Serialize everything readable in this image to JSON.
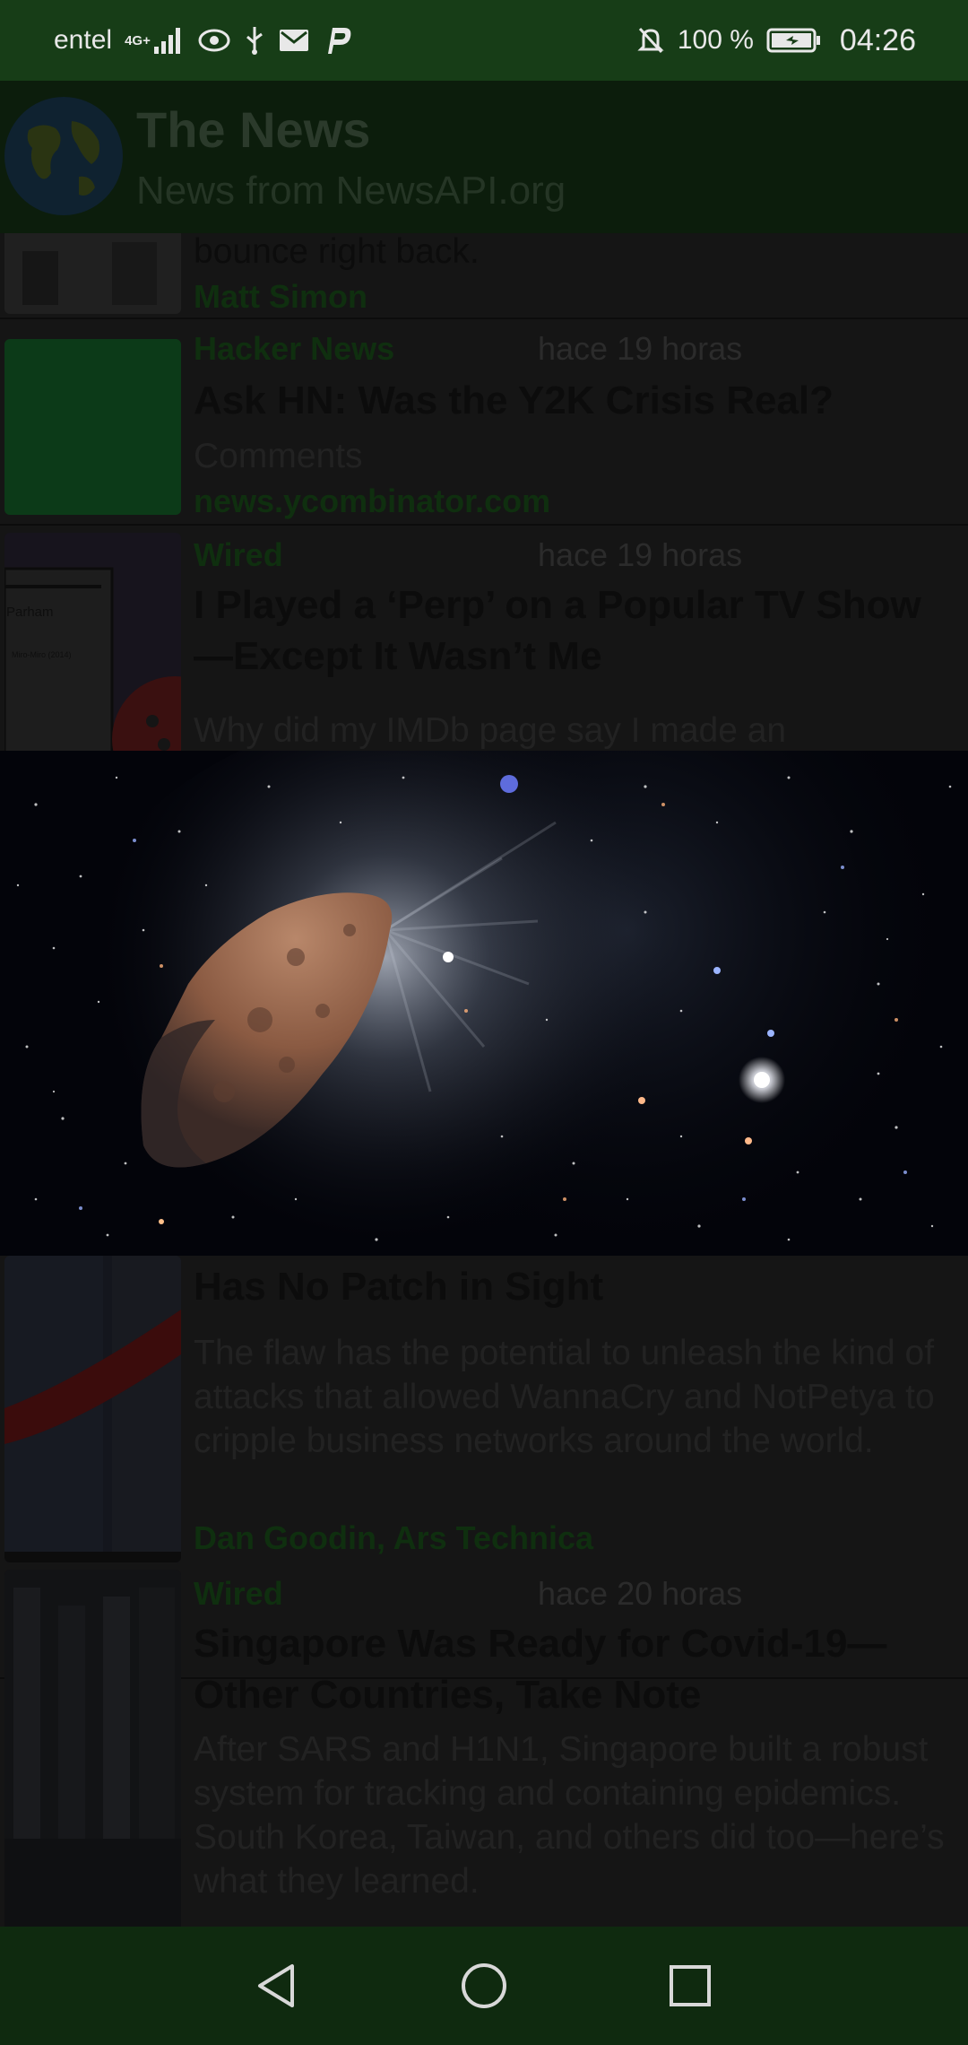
{
  "status_bar": {
    "carrier": "entel",
    "network": "4G+",
    "battery": "100 %",
    "time": "04:26",
    "icons": [
      "signal-icon",
      "eye-icon",
      "usb-icon",
      "gmail-icon",
      "parking-icon",
      "mute-icon",
      "battery-charging-icon"
    ]
  },
  "app_bar": {
    "title": "The News",
    "subtitle": "News from NewsAPI.org",
    "logo_icon": "globe-icon"
  },
  "articles": [
    {
      "title": "bounce right back.",
      "author": "Matt Simon"
    },
    {
      "source": "Hacker News",
      "time": "hace 19 horas",
      "title": "Ask HN: Was the Y2K Crisis Real?",
      "description": "Comments",
      "author": "news.ycombinator.com"
    },
    {
      "source": "Wired",
      "time": "hace 19 horas",
      "title": "I Played a ‘Perp’ on a Popular TV Show—Except It Wasn’t Me",
      "description": "Why did my IMDb page say I made an",
      "thumb_text_1": "Parham",
      "thumb_text_2": "Miro-Miro (2014)"
    },
    {
      "title": "Has No Patch in Sight",
      "description": "The flaw has the potential to unleash the kind of attacks that allowed WannaCry and NotPetya to cripple business networks around the world.",
      "author": "Dan Goodin, Ars Technica"
    },
    {
      "source": "Wired",
      "time": "hace 20 horas",
      "title": "Singapore Was Ready for Covid-19—Other Countries, Take Note",
      "description": "After SARS and H1N1, Singapore built a robust system for tracking and containing epidemics. South Korea, Taiwan, and others did too—here’s what they learned."
    }
  ],
  "image_preview": {
    "icon": "asteroid-space-image"
  },
  "nav_bar": {
    "buttons": [
      "back-icon",
      "home-icon",
      "recents-icon"
    ]
  }
}
